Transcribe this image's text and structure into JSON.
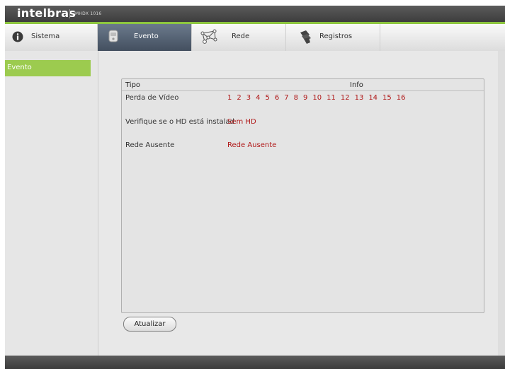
{
  "header": {
    "brand": "intelbras",
    "model": "MHDX 1016"
  },
  "tabs": [
    {
      "label": "Sistema",
      "icon": "info-icon",
      "active": false
    },
    {
      "label": "Evento",
      "icon": "event-icon",
      "active": true
    },
    {
      "label": "Rede",
      "icon": "network-icon",
      "active": false
    },
    {
      "label": "Registros",
      "icon": "log-icon",
      "active": false
    }
  ],
  "sidebar": {
    "items": [
      {
        "label": "Evento",
        "active": true
      }
    ]
  },
  "table": {
    "headers": {
      "type": "Tipo",
      "info": "Info"
    },
    "rows": [
      {
        "type": "Perda de Vídeo",
        "channels": [
          "1",
          "2",
          "3",
          "4",
          "5",
          "6",
          "7",
          "8",
          "9",
          "10",
          "11",
          "12",
          "13",
          "14",
          "15",
          "16"
        ]
      },
      {
        "type": "Verifique se o HD está instalad",
        "info": "Sem HD"
      },
      {
        "type": "Rede Ausente",
        "info": "Rede Ausente"
      }
    ]
  },
  "buttons": {
    "refresh": "Atualizar"
  },
  "colors": {
    "accent_green": "#8dc63f",
    "sidebar_active": "#9ccb4f",
    "alert_red": "#b01818",
    "active_tab": "#55637a"
  }
}
